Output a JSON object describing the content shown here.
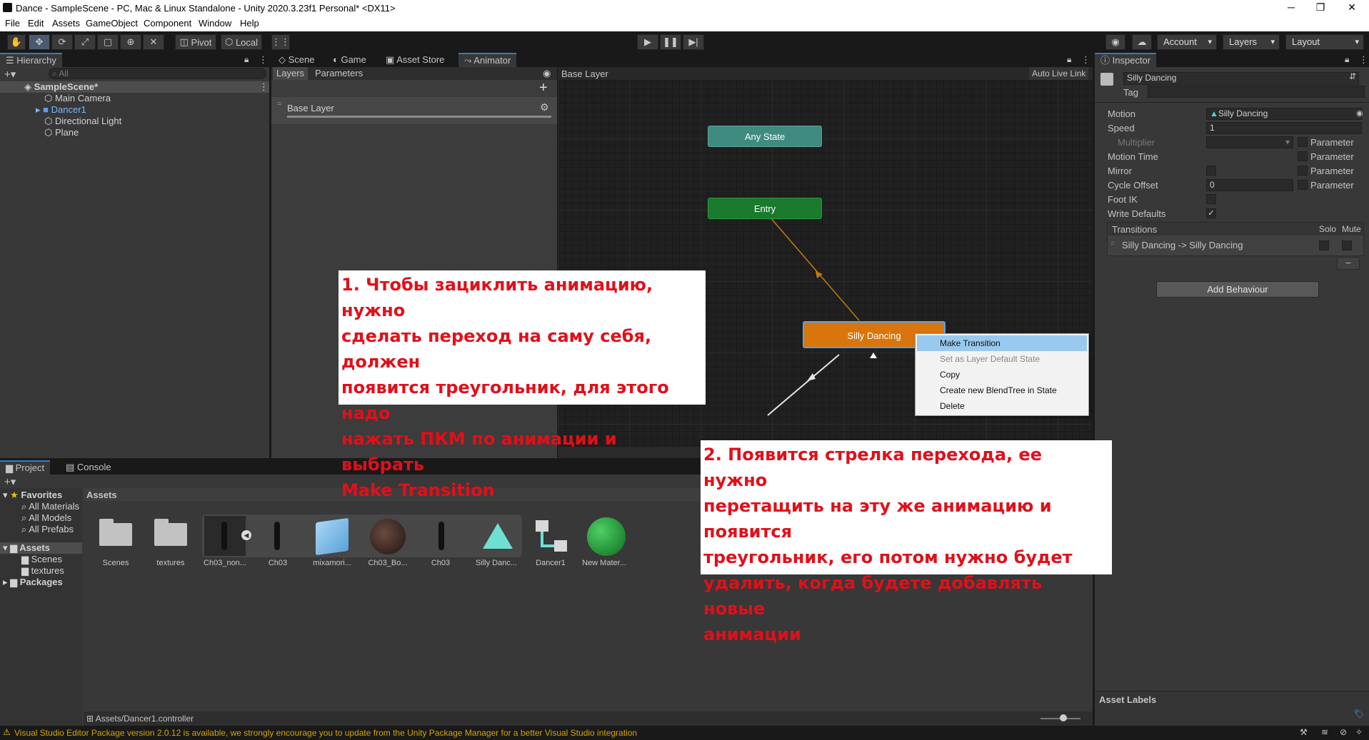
{
  "window": {
    "title": "Dance - SampleScene - PC, Mac & Linux Standalone - Unity 2020.3.23f1 Personal* <DX11>",
    "minimize": "─",
    "maximize": "❐",
    "close": "✕"
  },
  "menu": [
    "File",
    "Edit",
    "Assets",
    "GameObject",
    "Component",
    "Window",
    "Help"
  ],
  "toolbar": {
    "pivot": "Pivot",
    "local": "Local",
    "account": "Account",
    "layers": "Layers",
    "layout": "Layout"
  },
  "hierarchy": {
    "tab": "Hierarchy",
    "search_placeholder": "All",
    "scene": "SampleScene*",
    "items": [
      "Main Camera",
      "Dancer1",
      "Directional Light",
      "Plane"
    ]
  },
  "center_tabs": [
    "Scene",
    "Game",
    "Asset Store",
    "Animator"
  ],
  "animator": {
    "left_tabs": [
      "Layers",
      "Parameters"
    ],
    "layer": "Base Layer",
    "breadcrumb": "Base Layer",
    "auto_live_link": "Auto Live Link",
    "nodes": {
      "any_state": "Any State",
      "entry": "Entry",
      "silly_dancing": "Silly Dancing"
    }
  },
  "context_menu": {
    "items": [
      "Make Transition",
      "Set as Layer Default State",
      "Copy",
      "Create new BlendTree in State",
      "Delete"
    ]
  },
  "notes": {
    "note1": "1. Чтобы зациклить анимацию, нужно\nсделать переход на саму себя, должен\nпоявится треугольник, для этого надо\nнажать ПКМ по анимации и выбрать\nMake Transition",
    "note2": "2. Появится стрелка перехода, ее нужно\nперетащить на эту же анимацию и появится\nтреугольник, его потом нужно будет\nудалить, когда будете добавлять новые\nанимации"
  },
  "project": {
    "tabs": [
      "Project",
      "Console"
    ],
    "favorites_label": "Favorites",
    "favorites": [
      "All Materials",
      "All Models",
      "All Prefabs"
    ],
    "assets_label": "Assets",
    "assets_children": [
      "Scenes",
      "textures"
    ],
    "packages_label": "Packages",
    "assets_header": "Assets",
    "asset_items": [
      "Scenes",
      "textures",
      "Ch03_non...",
      "Ch03",
      "mixamori...",
      "Ch03_Bo...",
      "Ch03",
      "Silly Danc...",
      "Dancer1",
      "New Mater..."
    ],
    "path": "Assets/Dancer1.controller"
  },
  "inspector": {
    "tab": "Inspector",
    "name": "Silly Dancing",
    "tag_label": "Tag",
    "motion_label": "Motion",
    "motion_value": "Silly Dancing",
    "speed_label": "Speed",
    "speed_value": "1",
    "multiplier_label": "Multiplier",
    "motion_time_label": "Motion Time",
    "mirror_label": "Mirror",
    "cycle_offset_label": "Cycle Offset",
    "cycle_offset_value": "0",
    "foot_ik_label": "Foot IK",
    "write_defaults_label": "Write Defaults",
    "parameter": "Parameter",
    "transitions_label": "Transitions",
    "solo": "Solo",
    "mute": "Mute",
    "transition": "Silly Dancing -> Silly Dancing",
    "add_behaviour": "Add Behaviour",
    "asset_labels": "Asset Labels",
    "minus": "−",
    "check": "✓"
  },
  "status": {
    "message": "Visual Studio Editor Package version 2.0.12 is available, we strongly encourage you to update from the Unity Package Manager for a better Visual Studio integration"
  }
}
